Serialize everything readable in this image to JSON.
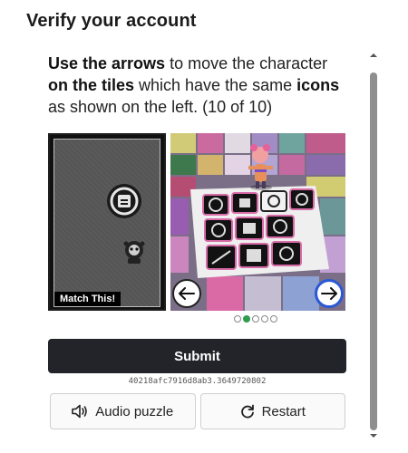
{
  "header": {
    "title": "Verify your account"
  },
  "instructions": {
    "part1_bold": "Use the arrows",
    "part2": " to move the character ",
    "part3_bold": "on the tiles",
    "part4": " which have the same ",
    "part5_bold": "icons",
    "part6": " as shown on the left. (10 of 10)"
  },
  "left_panel": {
    "badge": "Match This!",
    "icons": [
      "lock-circle-icon",
      "creature-icon"
    ]
  },
  "right_panel": {
    "prev_icon": "arrow-left-icon",
    "next_icon": "arrow-right-icon"
  },
  "pager": {
    "count": 5,
    "active_index": 1
  },
  "actions": {
    "submit_label": "Submit",
    "session_id": "40218afc7916d8ab3.3649720802",
    "audio_label": "Audio puzzle",
    "audio_icon": "speaker-icon",
    "restart_label": "Restart",
    "restart_icon": "refresh-icon"
  },
  "colors": {
    "submit_bg": "#222429",
    "active_dot": "#2e9d4e",
    "next_border": "#2a58d6"
  }
}
